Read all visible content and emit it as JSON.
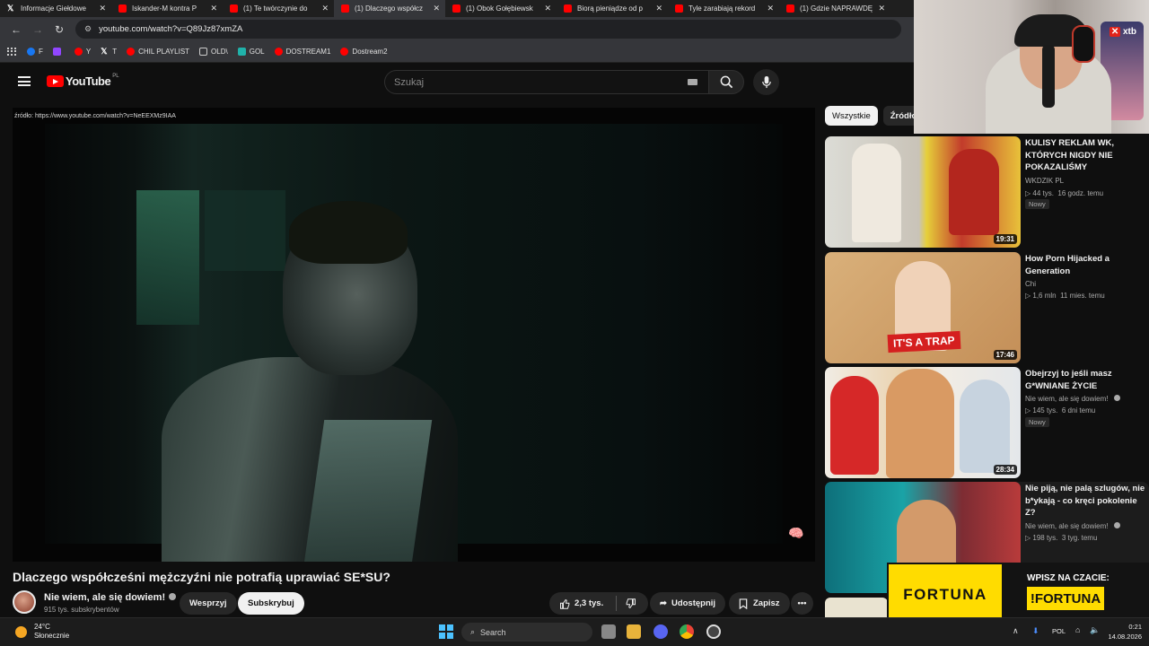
{
  "browser": {
    "tabs": [
      {
        "label": "Informacje Giełdowe",
        "icon": "x-icon"
      },
      {
        "label": "Iskander-M kontra P",
        "icon": "youtube-icon"
      },
      {
        "label": "(1) Te twórczynie do",
        "icon": "youtube-icon"
      },
      {
        "label": "(1) Dlaczego współcz",
        "icon": "youtube-icon",
        "active": true
      },
      {
        "label": "(1) Obok Gołębiewsk",
        "icon": "youtube-icon"
      },
      {
        "label": "Biorą pieniądze od p",
        "icon": "youtube-icon"
      },
      {
        "label": "Tyle zarabiają rekord",
        "icon": "youtube-icon"
      },
      {
        "label": "(1) Gdzie NAPRAWDĘ",
        "icon": "youtube-icon"
      }
    ],
    "url": "youtube.com/watch?v=Q89Jz87xmZA",
    "bookmarks": [
      {
        "label": "F",
        "color": "#1877f2"
      },
      {
        "label": "",
        "color": "#9146ff"
      },
      {
        "label": "Y",
        "color": "#ff0000"
      },
      {
        "label": "T",
        "color": "#000000"
      },
      {
        "label": "CHIL PLAYLIST",
        "color": "#ff0000"
      },
      {
        "label": "OLD\\",
        "color": "#cccccc"
      },
      {
        "label": "GOL",
        "color": "#20b2aa"
      },
      {
        "label": "DOSTREAM1",
        "color": "#ff0000"
      },
      {
        "label": "Dostream2",
        "color": "#ff0000"
      }
    ]
  },
  "youtube": {
    "logo_text": "YouTube",
    "country_code": "PL",
    "search_placeholder": "Szukaj",
    "video": {
      "source_label": "źródło: https://www.youtube.com/watch?v=NeEEXMz9IAA",
      "title": "Dlaczego współcześni mężczyźni nie potrafią uprawiać SE*SU?",
      "channel_name": "Nie wiem, ale się dowiem!",
      "subscribers": "915 tys. subskrybentów",
      "support_label": "Wesprzyj",
      "subscribe_label": "Subskrybuj",
      "likes": "2,3 tys.",
      "share_label": "Udostępnij",
      "save_label": "Zapisz"
    },
    "chips": [
      "Wszystkie",
      "Źródło"
    ],
    "recommendations": [
      {
        "title": "KULISY REKLAM WK, KTÓRYCH NIGDY NIE POKAZALIŚMY",
        "channel": "WKDZIK PL",
        "views": "44 tys.",
        "age": "16 godz. temu",
        "duration": "19:31",
        "badge": "Nowy"
      },
      {
        "title": "How Porn Hijacked a Generation",
        "channel": "Chi",
        "views": "1,6 mln",
        "age": "11 mies. temu",
        "duration": "17:46",
        "thumb_text": "IT'S A TRAP",
        "badge": ""
      },
      {
        "title": "Obejrzyj to jeśli masz G*WNIANE ŻYCIE",
        "channel": "Nie wiem, ale się dowiem!",
        "views": "145 tys.",
        "age": "6 dni temu",
        "duration": "28:34",
        "badge": "Nowy"
      },
      {
        "title": "Nie piją, nie palą szlugów, nie b*ykają - co kręci pokolenie Z?",
        "channel": "Nie wiem, ale się dowiem!",
        "views": "198 tys.",
        "age": "3 tyg. temu",
        "duration": "",
        "badge": ""
      }
    ]
  },
  "overlay": {
    "webcam_brand": "xtb",
    "ad_brand": "FORTUNA",
    "ad_prompt": "WPISZ NA CZACIE:",
    "ad_command": "!FORTUNA"
  },
  "taskbar": {
    "temperature": "24°C",
    "weather": "Słonecznie",
    "search_placeholder": "Search",
    "language": "POL",
    "time": "0:21",
    "date": "14.08.2026"
  }
}
